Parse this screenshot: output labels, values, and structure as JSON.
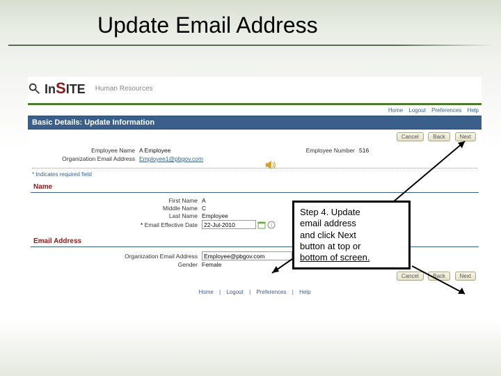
{
  "slide_title": "Update Email Address",
  "logo": {
    "text_in": "In",
    "text_s": "S",
    "text_ite": "ITE",
    "subtitle": "Human Resources"
  },
  "nav": {
    "home": "Home",
    "logout": "Logout",
    "preferences": "Preferences",
    "help": "Help"
  },
  "section_title": "Basic Details: Update Information",
  "buttons": {
    "cancel": "Cancel",
    "back": "Back",
    "next": "Next"
  },
  "summary": {
    "emp_name_label": "Employee Name",
    "emp_name_value": "A Employee",
    "org_email_label": "Organization Email Address",
    "org_email_value": "Employee1@pbgov.com",
    "emp_num_label": "Employee Number",
    "emp_num_value": "516"
  },
  "required_note": "* Indicates required field",
  "name_section": {
    "title": "Name",
    "first_label": "First Name",
    "first_value": "A",
    "middle_label": "Middle Name",
    "middle_value": "C",
    "last_label": "Last Name",
    "last_value": "Employee",
    "eff_label": "Email Effective Date",
    "eff_value": "22-Jul-2010"
  },
  "email_section": {
    "title": "Email Address",
    "org_email_label": "Organization Email Address",
    "org_email_value": "Employee@pbgov.com",
    "gender_label": "Gender",
    "gender_value": "Female"
  },
  "footer": {
    "home": "Home",
    "logout": "Logout",
    "preferences": "Preferences",
    "help": "Help",
    "sep": "|"
  },
  "callout": {
    "l1": "Step 4. Update",
    "l2": "email address",
    "l3": "and click Next",
    "l4": "button at top or",
    "l5": "bottom of screen."
  }
}
